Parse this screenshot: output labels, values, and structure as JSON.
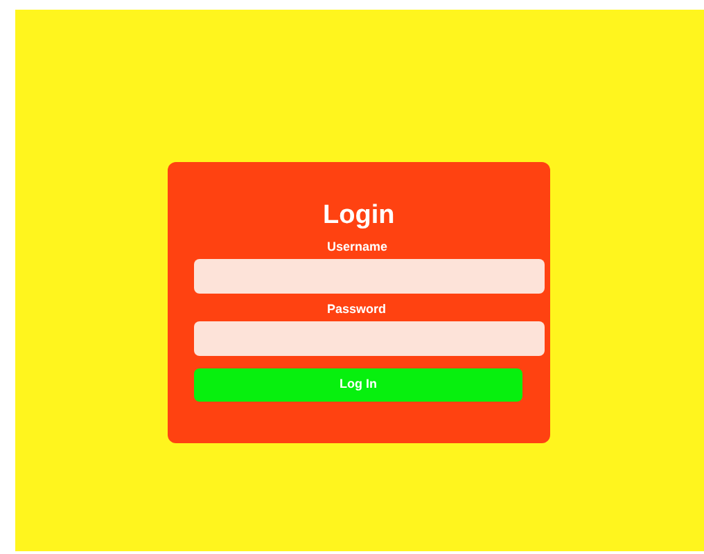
{
  "title": "Login",
  "fields": [
    {
      "label": "Username"
    },
    {
      "label": "Password"
    }
  ],
  "button": "Log In"
}
